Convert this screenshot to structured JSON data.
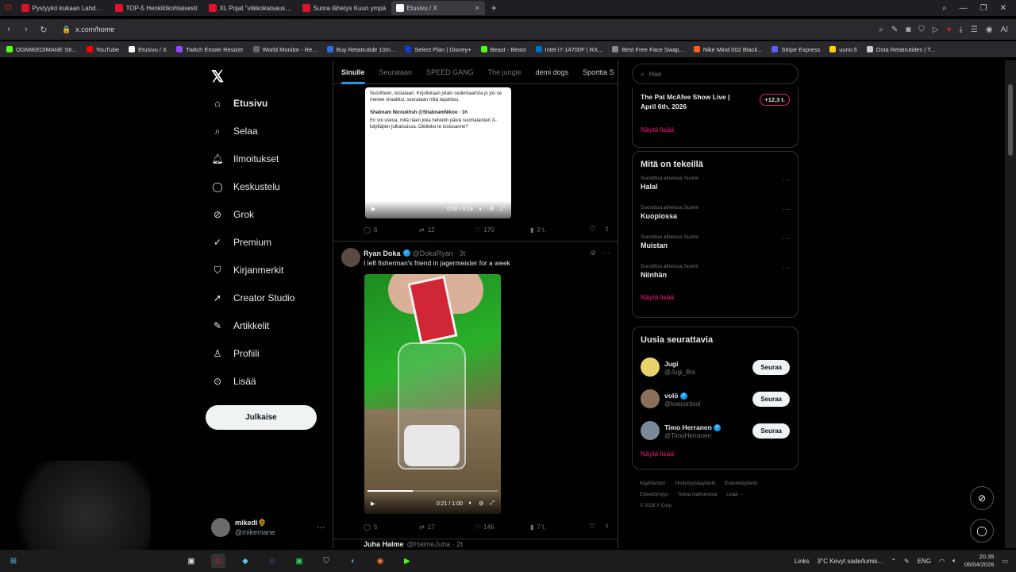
{
  "browser": {
    "tabs": [
      {
        "label": "Pystyykö kukaan Lahdess",
        "color": "#e0112b"
      },
      {
        "label": "TOP-5 Henkilökohtaisesti",
        "color": "#e0112b"
      },
      {
        "label": "XL Pojat \"viikkokatsaus\" 5",
        "color": "#e0112b"
      },
      {
        "label": "Suora lähetys Kuun ympä",
        "color": "#e0112b"
      },
      {
        "label": "Etusivu / X",
        "color": "#ffffff"
      }
    ],
    "url": "x.com/home",
    "bookmarks": [
      "OGMIKEDIMANE Str...",
      "YouTube",
      "Etusivu / X",
      "Twitch Emote Resizer",
      "World Monitor - Re...",
      "Buy Retatrutide 10m...",
      "Select Plan | Disney+",
      "Beast - Beast",
      "Intel i7-14700F | RX...",
      "Best Free Face Swap...",
      "Nike Mind 002 Black...",
      "Stripe Express",
      "uuno.fi",
      "Osta Retatrutides | T..."
    ]
  },
  "nav": {
    "items": [
      {
        "label": "Etusivu",
        "icon": "home-icon"
      },
      {
        "label": "Selaa",
        "icon": "search-icon"
      },
      {
        "label": "Ilmoitukset",
        "icon": "bell-icon"
      },
      {
        "label": "Keskustelu",
        "icon": "chat-icon"
      },
      {
        "label": "Grok",
        "icon": "grok-icon"
      },
      {
        "label": "Premium",
        "icon": "premium-icon"
      },
      {
        "label": "Kirjanmerkit",
        "icon": "bookmark-icon"
      },
      {
        "label": "Creator Studio",
        "icon": "rocket-icon"
      },
      {
        "label": "Artikkelit",
        "icon": "article-icon"
      },
      {
        "label": "Profiili",
        "icon": "person-icon"
      },
      {
        "label": "Lisää",
        "icon": "more-circle-icon"
      }
    ],
    "post_label": "Julkaise",
    "profile": {
      "name": "mikedi🌻",
      "handle": "@mikemane"
    }
  },
  "feed": {
    "tabs": [
      "Sinulle",
      "Seurataan",
      "SPEED GANG",
      "The jungle",
      "demi dogs",
      "Sporttia S"
    ],
    "tweet1": {
      "media_text": "Suoritteen, testataan. Kirjoitetaan jotain sedentaarista jo jos se menee viraaliksi, seurataan mitä tapahtuu.",
      "quote_author": "Shabnam Nicoukhsh @ShabnamNikoo · 1h",
      "quote_text": "En voi uskoa, mitä näen joka helvetin päivä suomalaisten X-käyttäjien julkaisuissa. Oletteko te tosissanne?",
      "video_time": "0:08 / 0:18",
      "replies": "6",
      "reposts": "12",
      "likes": "170",
      "views": "3 t."
    },
    "tweet2": {
      "name": "Ryan Doka",
      "handle": "@DokaRyan · 3t",
      "text": "I left fisherman's friend in jagermeister for a week",
      "video_time": "0:21 / 1:00",
      "progress": 0.35,
      "replies": "5",
      "reposts": "17",
      "likes": "146",
      "views": "7 t."
    },
    "tweet3": {
      "name": "Juha Halme",
      "handle": "@HalmeJuha · 2t"
    }
  },
  "right": {
    "search_placeholder": "Hae",
    "live": {
      "title": "The Pat McAfee Show Live | April 6th, 2026",
      "count": "+12,3 t."
    },
    "show_more": "Näytä lisää",
    "trending_title": "Mitä on tekeillä",
    "trends": [
      {
        "ctx": "Suosittua aiheissa Suomi",
        "title": "Halal"
      },
      {
        "ctx": "Suosittua aiheissa Suomi",
        "title": "Kuopiossa"
      },
      {
        "ctx": "Suosittua aiheissa Suomi",
        "title": "Muistan"
      },
      {
        "ctx": "Suosittua aiheissa Suomi",
        "title": "Niinhän"
      }
    ],
    "follow_title": "Uusia seurattavia",
    "follow_button": "Seuraa",
    "follows": [
      {
        "name": "Jugi",
        "handle": "@Jugi_Boi",
        "color": "#e8d36a"
      },
      {
        "name": "volö",
        "handle": "@lowcortisol",
        "color": "#8a6f5a"
      },
      {
        "name": "Timo Herranen",
        "handle": "@TimoHerranen",
        "color": "#7a8899"
      }
    ],
    "footer": [
      "Käyttöehdot",
      "Yksityisyyskäytäntö",
      "Evästekäytäntö",
      "Esteettömyys",
      "Tietoa mainoksista",
      "Lisää ···",
      "© 2026 X Corp."
    ]
  },
  "taskbar": {
    "links": "Links",
    "weather": "3°C  Kevyt sade/lumis...",
    "lang": "ENG",
    "time": "20.35",
    "date": "06/04/2026"
  }
}
